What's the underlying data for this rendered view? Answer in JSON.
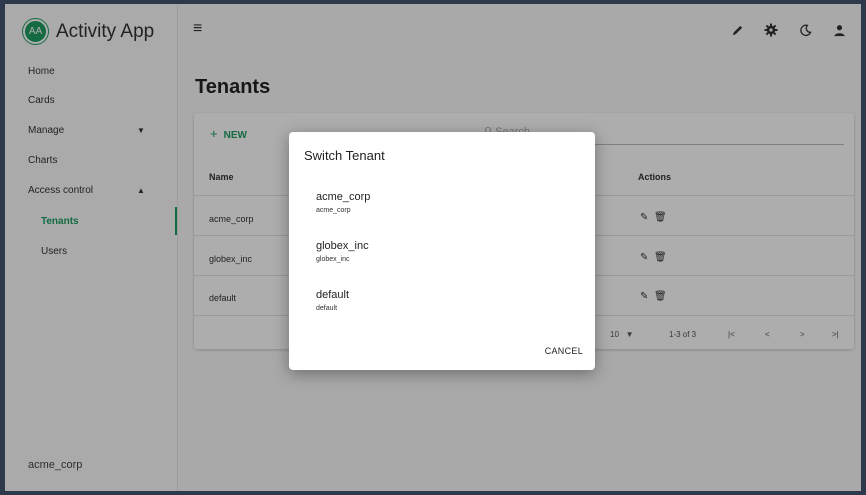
{
  "app": {
    "avatar": "AA",
    "title": "Activity App"
  },
  "sidebar": {
    "items": [
      {
        "label": "Home"
      },
      {
        "label": "Cards"
      },
      {
        "label": "Manage",
        "chevron": "▼"
      },
      {
        "label": "Charts"
      },
      {
        "label": "Access control",
        "chevron": "▲"
      },
      {
        "label": "Tenants"
      },
      {
        "label": "Users"
      }
    ],
    "footer": "acme_corp"
  },
  "topbar": {
    "menu_icon": "≡"
  },
  "page": {
    "title": "Tenants"
  },
  "table": {
    "new_label": "NEW",
    "search_placeholder": "Search",
    "columns": [
      "Name",
      "Actions"
    ],
    "rows": [
      {
        "name": "acme_corp"
      },
      {
        "name": "globex_inc"
      },
      {
        "name": "default"
      }
    ],
    "rows_per_page": "10",
    "range": "1-3 of 3",
    "pager_icons": [
      "|<",
      "<",
      ">",
      ">|"
    ]
  },
  "dialog": {
    "title": "Switch Tenant",
    "options": [
      {
        "name": "acme_corp",
        "id": "acme_corp"
      },
      {
        "name": "globex_inc",
        "id": "globex_inc"
      },
      {
        "name": "default",
        "id": "default"
      }
    ],
    "cancel_label": "CANCEL"
  },
  "colors": {
    "accent": "#1e9e62",
    "border": "#2e3a4b"
  }
}
